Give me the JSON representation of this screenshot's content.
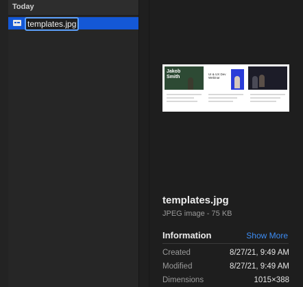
{
  "list": {
    "section_title": "Today",
    "file_name": "templates.jpg"
  },
  "preview": {
    "thumbnail": {
      "panel1_heading": "Jakob Smith",
      "panel2_heading": "UI & UX Dev Webinar"
    },
    "title": "templates.jpg",
    "subtitle": "JPEG image - 75 KB",
    "info_heading": "Information",
    "show_more": "Show More",
    "rows": [
      {
        "label": "Created",
        "value": "8/27/21, 9:49 AM"
      },
      {
        "label": "Modified",
        "value": "8/27/21, 9:49 AM"
      },
      {
        "label": "Dimensions",
        "value": "1015×388"
      }
    ]
  },
  "colors": {
    "selection": "#1458d6",
    "link": "#3d8df5",
    "background": "#1e1e1e"
  }
}
